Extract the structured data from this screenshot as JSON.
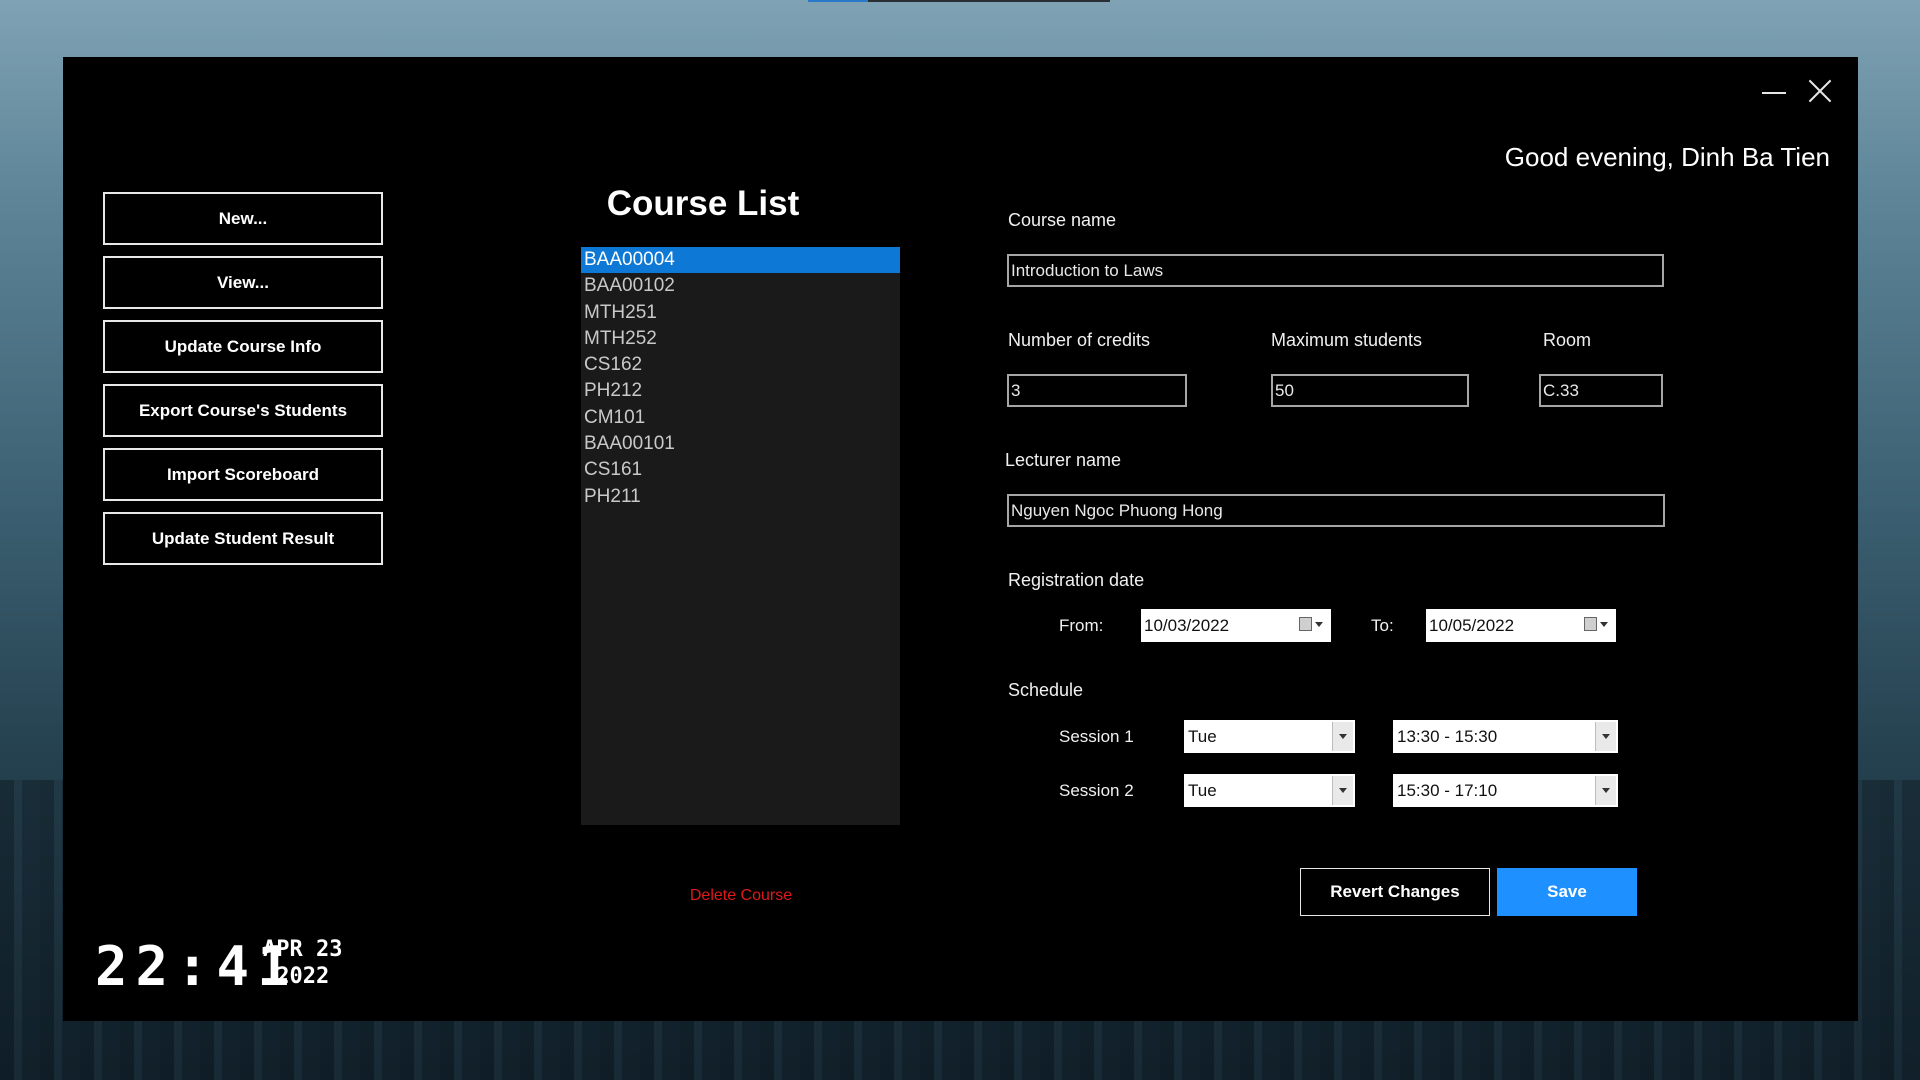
{
  "greeting": "Good evening, Dinh Ba Tien",
  "sidebar": {
    "buttons": [
      {
        "label": "New..."
      },
      {
        "label": "View..."
      },
      {
        "label": "Update Course Info"
      },
      {
        "label": "Export Course's Students"
      },
      {
        "label": "Import Scoreboard"
      },
      {
        "label": "Update Student Result"
      }
    ]
  },
  "course_list": {
    "title": "Course List",
    "items": [
      "BAA00004",
      "BAA00102",
      "MTH251",
      "MTH252",
      "CS162",
      "PH212",
      "CM101",
      "BAA00101",
      "CS161",
      "PH211"
    ],
    "selected_index": 0,
    "delete_label": "Delete Course"
  },
  "form": {
    "course_name_label": "Course name",
    "course_name": "Introduction to Laws",
    "credits_label": "Number of credits",
    "credits": "3",
    "max_students_label": "Maximum students",
    "max_students": "50",
    "room_label": "Room",
    "room": "C.33",
    "lecturer_label": "Lecturer name",
    "lecturer": "Nguyen Ngoc Phuong Hong",
    "registration_label": "Registration date",
    "from_label": "From:",
    "from_date": "10/03/2022",
    "to_label": "To:",
    "to_date": "10/05/2022",
    "schedule_label": "Schedule",
    "session1_label": "Session 1",
    "session1_day": "Tue",
    "session1_time": "13:30 - 15:30",
    "session2_label": "Session 2",
    "session2_day": "Tue",
    "session2_time": "15:30 - 17:10"
  },
  "actions": {
    "revert_label": "Revert Changes",
    "save_label": "Save"
  },
  "clock": {
    "time": "22:41",
    "month_day": "APR 23",
    "year": "2022"
  },
  "colors": {
    "accent": "#1e90ff",
    "selected": "#0e78d6",
    "delete": "#e01919"
  }
}
